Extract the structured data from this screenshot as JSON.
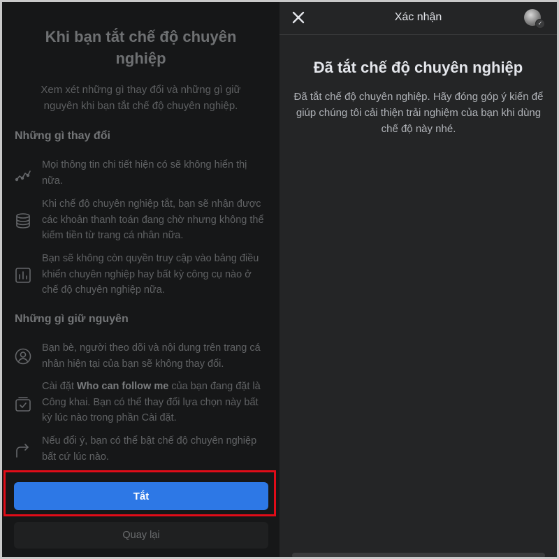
{
  "left": {
    "title": "Khi bạn tắt chế độ chuyên nghiệp",
    "subtitle": "Xem xét những gì thay đổi và những gì giữ nguyên khi bạn tắt chế độ chuyên nghiệp.",
    "changes_heading": "Những gì thay đổi",
    "changes": [
      {
        "icon": "trend-line-icon",
        "text": "Mọi thông tin chi tiết hiện có sẽ không hiển thị nữa."
      },
      {
        "icon": "coin-stack-icon",
        "text": "Khi chế độ chuyên nghiệp tắt, bạn sẽ nhận được các khoản thanh toán đang chờ nhưng không thể kiếm tiền từ trang cá nhân nữa."
      },
      {
        "icon": "bar-chart-icon",
        "text": "Bạn sẽ không còn quyền truy cập vào bảng điều khiển chuyên nghiệp hay bất kỳ công cụ nào ở chế độ chuyên nghiệp nữa."
      }
    ],
    "same_heading": "Những gì giữ nguyên",
    "same": [
      {
        "icon": "person-circle-icon",
        "text": "Bạn bè, người theo dõi và nội dung trên trang cá nhân hiện tại của bạn sẽ không thay đổi."
      },
      {
        "icon": "checkbox-tray-icon",
        "text_before": "Cài đặt ",
        "text_bold": "Who can follow me",
        "text_after": " của bạn đang đặt là Công khai. Bạn có thể thay đổi lựa chọn này bất kỳ lúc nào trong phần Cài đặt."
      },
      {
        "icon": "redo-arrow-icon",
        "text": "Nếu đổi ý, bạn có thể bật chế độ chuyên nghiệp bất cứ lúc nào."
      }
    ],
    "primary_button": "Tắt",
    "secondary_button": "Quay lại"
  },
  "right": {
    "topbar_title": "Xác nhận",
    "heading": "Đã tắt chế độ chuyên nghiệp",
    "body": "Đã tắt chế độ chuyên nghiệp. Hãy đóng góp ý kiến để giúp chúng tôi cải thiện trải nghiệm của bạn khi dùng chế độ này nhé."
  },
  "colors": {
    "primary_button": "#2d78e6",
    "highlight_box": "#e00c18",
    "left_background": "#161718",
    "right_background": "#242526"
  }
}
